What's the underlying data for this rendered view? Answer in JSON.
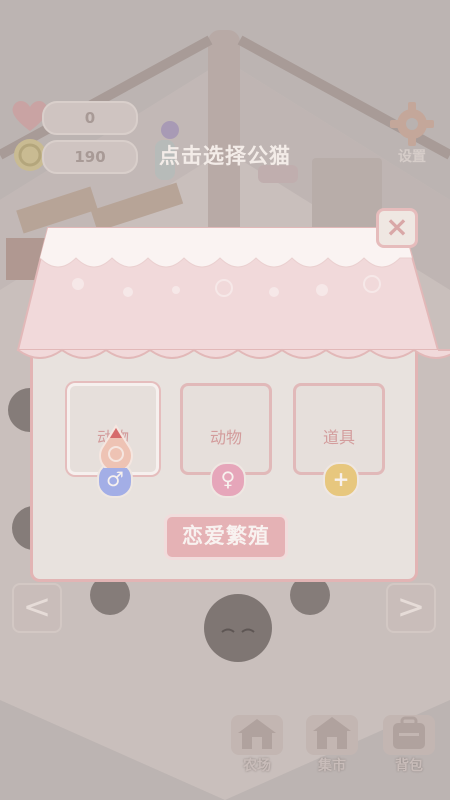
{
  "hud": {
    "hearts": "0",
    "coins": "190",
    "settings_label": "设置"
  },
  "prompt": "点击选择公猫",
  "dialog": {
    "slots": [
      {
        "label": "动物",
        "badge": "♂",
        "badge_color": "#a3aee6"
      },
      {
        "label": "动物",
        "badge": "♀",
        "badge_color": "#e6a6ba"
      },
      {
        "label": "道具",
        "badge": "+",
        "badge_color": "#e7c77e"
      }
    ],
    "breed_label": "恋爱繁殖",
    "close_label": "×"
  },
  "nav": {
    "prev": "<",
    "next": ">"
  },
  "bottom": [
    {
      "label": "农场",
      "icon": "house-icon"
    },
    {
      "label": "集市",
      "icon": "market-icon"
    },
    {
      "label": "背包",
      "icon": "backpack-icon"
    }
  ],
  "colors": {
    "accent": "#e5b2b5",
    "male": "#a3aee6",
    "female": "#e6a6ba",
    "item": "#e7c77e"
  }
}
